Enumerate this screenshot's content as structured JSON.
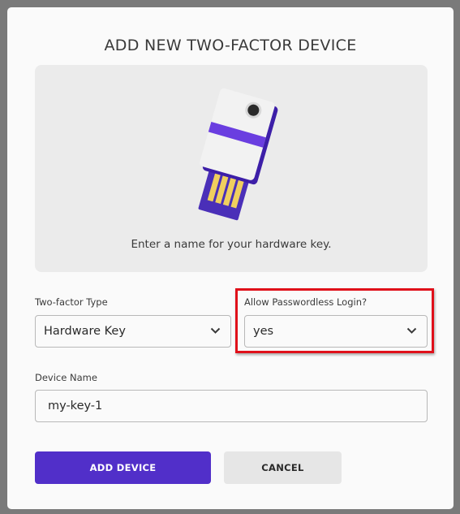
{
  "dialog": {
    "title": "ADD NEW TWO-FACTOR DEVICE",
    "illustration": {
      "caption": "Enter a name for your hardware key.",
      "icon": "hardware-key-icon"
    },
    "two_factor_type": {
      "label": "Two-factor Type",
      "value": "Hardware Key"
    },
    "passwordless": {
      "label": "Allow Passwordless Login?",
      "value": "yes"
    },
    "device_name": {
      "label": "Device Name",
      "value": "my-key-1"
    },
    "buttons": {
      "add": "ADD DEVICE",
      "cancel": "CANCEL"
    }
  },
  "colors": {
    "accent": "#512fc9",
    "highlight": "#e0101a"
  }
}
